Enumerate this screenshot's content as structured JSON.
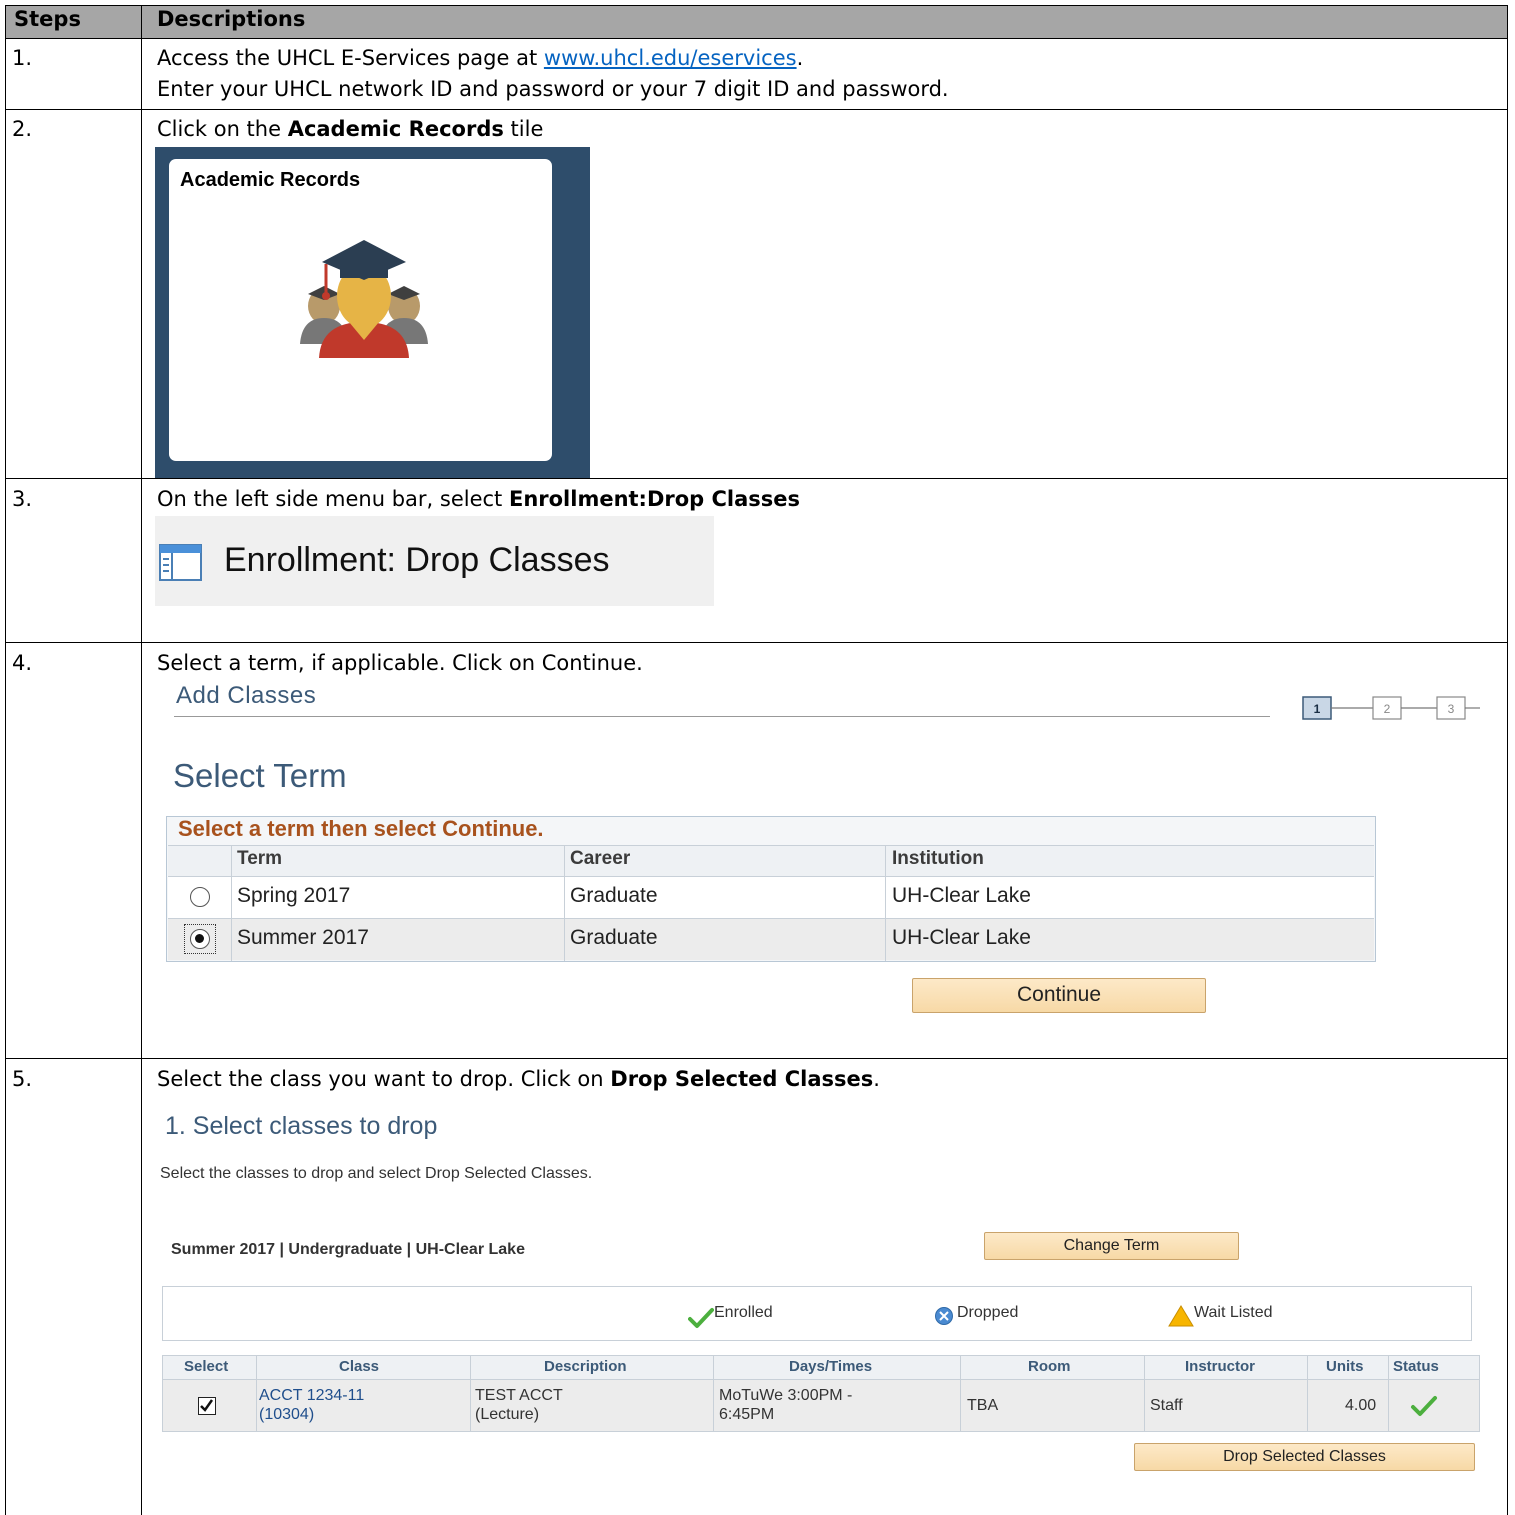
{
  "table": {
    "header": {
      "steps": "Steps",
      "descriptions": "Descriptions"
    },
    "rows": [
      {
        "num": "1.",
        "line1_pre": "Access the UHCL E-Services page at ",
        "link": "www.uhcl.edu/eservices",
        "line1_post": ".",
        "line2": "Enter your UHCL network ID and password or your 7 digit ID and password."
      },
      {
        "num": "2.",
        "pre": "Click on the ",
        "bold": "Academic Records",
        "post": " tile"
      },
      {
        "num": "3.",
        "pre": "On the left side menu bar, select ",
        "bold": "Enrollment:Drop Classes"
      },
      {
        "num": "4.",
        "text": "Select a term, if applicable. Click on Continue."
      },
      {
        "num": "5.",
        "pre": "Select the class you want to drop. Click on ",
        "bold": "Drop Selected Classes",
        "post": "."
      }
    ]
  },
  "tile": {
    "title": "Academic Records",
    "icon": "graduate-students-icon",
    "bg_color": "#2e4d6b"
  },
  "enroll_menu": {
    "label": "Enrollment:  Drop Classes",
    "icon": "page-icon"
  },
  "add_classes": {
    "title": "Add Classes",
    "steps": [
      "1",
      "2",
      "3"
    ],
    "select_term_heading": "Select Term",
    "instruction": "Select a term then select Continue.",
    "columns": [
      "Term",
      "Career",
      "Institution"
    ],
    "terms": [
      {
        "term": "Spring 2017",
        "career": "Graduate",
        "institution": "UH-Clear Lake",
        "selected": false
      },
      {
        "term": "Summer 2017",
        "career": "Graduate",
        "institution": "UH-Clear Lake",
        "selected": true
      }
    ],
    "continue_label": "Continue"
  },
  "drop": {
    "title": "1.  Select classes to drop",
    "subtitle": "Select the classes to drop and select Drop Selected Classes.",
    "term_label": "Summer 2017 | Undergraduate | UH-Clear Lake",
    "change_term_label": "Change Term",
    "legend": {
      "enrolled": "Enrolled",
      "dropped": "Dropped",
      "wait_listed": "Wait Listed"
    },
    "columns": [
      "Select",
      "Class",
      "Description",
      "Days/Times",
      "Room",
      "Instructor",
      "Units",
      "Status"
    ],
    "row": {
      "checked": true,
      "class_line1": "ACCT 1234-11",
      "class_line2": "(10304)",
      "desc_line1": "TEST ACCT",
      "desc_line2": "(Lecture)",
      "days_line1": "MoTuWe 3:00PM -",
      "days_line2": "6:45PM",
      "room": "TBA",
      "instructor": "Staff",
      "units": "4.00",
      "status": "enrolled"
    },
    "drop_button_label": "Drop Selected Classes"
  }
}
